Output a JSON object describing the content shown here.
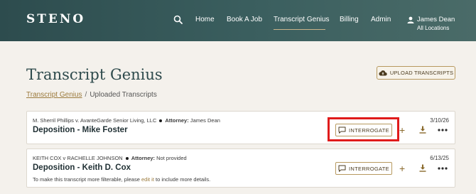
{
  "header": {
    "logo": "STENO",
    "nav": [
      "Home",
      "Book A Job",
      "Transcript Genius",
      "Billing",
      "Admin"
    ],
    "user_name": "James Dean",
    "user_location": "All Locations"
  },
  "page": {
    "title": "Transcript Genius",
    "upload_label": "UPLOAD TRANSCRIPTS",
    "breadcrumb": {
      "link": "Transcript Genius",
      "separator": "/",
      "current": "Uploaded Transcripts"
    }
  },
  "transcripts": [
    {
      "case": "M. Sherril Phillips v. AvanteGarde Senior Living, LLC",
      "attorney_label": "Attorney:",
      "attorney": "James Dean",
      "date": "3/10/26",
      "title": "Deposition - Mike Foster",
      "action_label": "INTERROGATE"
    },
    {
      "case": "KEITH COX v RACHELLE JOHNSON",
      "attorney_label": "Attorney:",
      "attorney": "Not provided",
      "date": "6/13/25",
      "title": "Deposition - Keith D. Cox",
      "hint_prefix": "To make this transcript more filterable, please",
      "hint_link": "edit it",
      "hint_suffix": "to include more details.",
      "action_label": "INTERROGATE"
    }
  ],
  "icons": {
    "search": "search-icon",
    "user": "user-icon",
    "upload": "cloud-upload-icon",
    "chat": "chat-icon",
    "add": "plus-icon",
    "download": "download-icon",
    "more": "more-icon"
  },
  "colors": {
    "header_bg": "#2d4c4e",
    "accent": "#b7995f",
    "highlight": "#e01b1b",
    "page_bg": "#f4f1ec"
  },
  "symbols": {
    "plus": "+"
  }
}
